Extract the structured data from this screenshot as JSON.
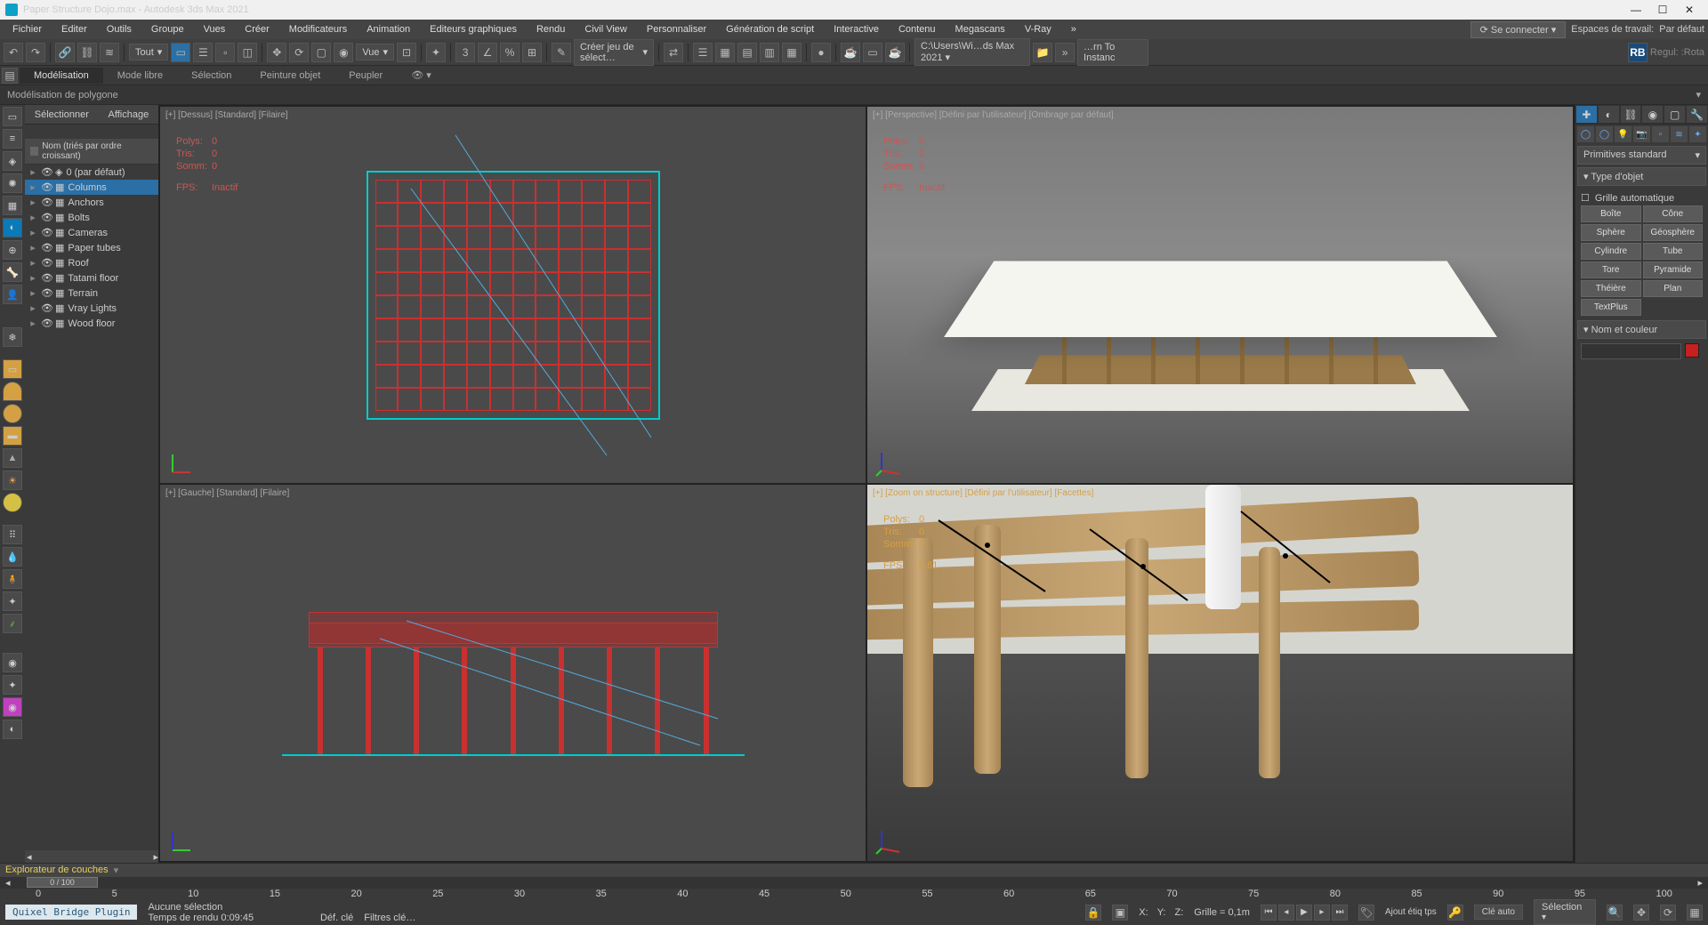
{
  "title": "Paper Structure Dojo.max - Autodesk 3ds Max 2021",
  "window": {
    "min": "—",
    "max": "☐",
    "close": "✕"
  },
  "menu": [
    "Fichier",
    "Editer",
    "Outils",
    "Groupe",
    "Vues",
    "Créer",
    "Modificateurs",
    "Animation",
    "Editeurs graphiques",
    "Rendu",
    "Civil View",
    "Personnaliser",
    "Génération de script",
    "Interactive",
    "Contenu",
    "Megascans",
    "V-Ray"
  ],
  "menu_more": "»",
  "signin": "⟳ Se connecter ▾",
  "workspace_lbl": "Espaces de travail:",
  "workspace_val": "Par défaut",
  "toolbar": {
    "all": "Tout",
    "view": "Vue",
    "create": "Créer jeu de sélect…",
    "path": "C:\\Users\\Wi…ds Max 2021 ▾",
    "rb": "RB",
    "instan": "…rn To Instanc",
    "reguk": "Regul:",
    "rota": ":Rota"
  },
  "ribbon": [
    "Modélisation",
    "Mode libre",
    "Sélection",
    "Peinture objet",
    "Peupler"
  ],
  "polyribbon": "Modélisation de polygone",
  "scene": {
    "sel": "Sélectionner",
    "aff": "Affichage",
    "sort": "Nom (triés par ordre croissant)"
  },
  "layers": [
    {
      "n": "0 (par défaut)",
      "sel": false,
      "icon": "◈"
    },
    {
      "n": "Columns",
      "sel": true
    },
    {
      "n": "Anchors",
      "sel": false
    },
    {
      "n": "Bolts",
      "sel": false
    },
    {
      "n": "Cameras",
      "sel": false
    },
    {
      "n": "Paper tubes",
      "sel": false
    },
    {
      "n": "Roof",
      "sel": false
    },
    {
      "n": "Tatami floor",
      "sel": false
    },
    {
      "n": "Terrain",
      "sel": false
    },
    {
      "n": "Vray Lights",
      "sel": false,
      "dim": true
    },
    {
      "n": "Wood floor",
      "sel": false
    }
  ],
  "vp": {
    "top": {
      "label": "[+] [Dessus] [Standard] [Filaire]",
      "polys": "0",
      "tris": "0",
      "somm": "0",
      "fps": "Inactif"
    },
    "persp": {
      "label": "[+] [Perspective] [Défini par l'utilisateur] [Ombrage par défaut]",
      "polys": "0",
      "tris": "0",
      "somm": "0",
      "fps": "Inactif"
    },
    "left": {
      "label": "[+] [Gauche] [Standard] [Filaire]",
      "polys": "",
      "tris": "",
      "somm": "",
      "fps": ""
    },
    "cam": {
      "label": "[+] [Zoom on structure] [Défini par l'utilisateur] [Facettes]",
      "polys": "0",
      "tris": "0",
      "somm": "0",
      "fps": "0,61"
    }
  },
  "stats_k": {
    "polys": "Polys:",
    "tris": "Tris:",
    "somm": "Somm:",
    "fps": "FPS:"
  },
  "right": {
    "primdd": "Primitives standard",
    "roll1": "Type d'objet",
    "autogrid": "Grille automatique",
    "prims": [
      "Boîte",
      "Cône",
      "Sphère",
      "Géosphère",
      "Cylindre",
      "Tube",
      "Tore",
      "Pyramide",
      "Théière",
      "Plan",
      "TextPlus",
      ""
    ],
    "roll2": "Nom et couleur"
  },
  "explorer": "Explorateur de couches",
  "timepos": "0 / 100",
  "ruler": [
    "0",
    "5",
    "10",
    "15",
    "20",
    "25",
    "30",
    "35",
    "40",
    "45",
    "50",
    "55",
    "60",
    "65",
    "70",
    "75",
    "80",
    "85",
    "90",
    "95",
    "100"
  ],
  "status": {
    "plugin": "Quixel Bridge Plugin",
    "nosel": "Aucune sélection",
    "render": "Temps de rendu 0:09:45",
    "x": "X:",
    "y": "Y:",
    "z": "Z:",
    "grid": "Grille = 0,1m",
    "tag": "Ajout étiq tps",
    "key": "Clé auto",
    "sel": "Sélection",
    "defkey": "Déf. clé",
    "filters": "Filtres clé…"
  }
}
